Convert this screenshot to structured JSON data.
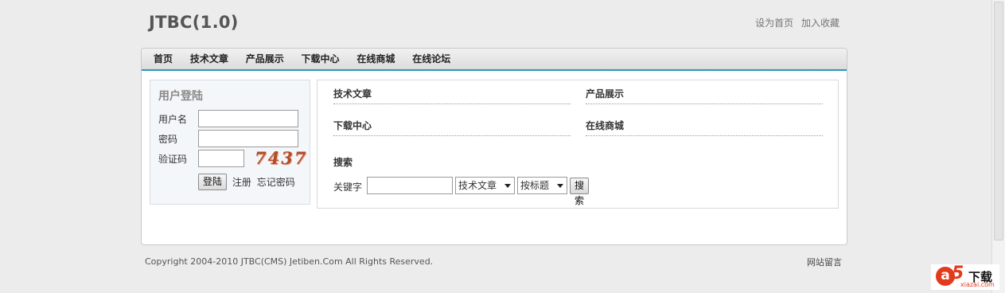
{
  "header": {
    "logo": "JTBC(1.0)",
    "links": [
      "设为首页",
      "加入收藏"
    ]
  },
  "nav": {
    "items": [
      "首页",
      "技术文章",
      "产品展示",
      "下载中心",
      "在线商城",
      "在线论坛"
    ]
  },
  "login": {
    "title": "用户登陆",
    "username_label": "用户名",
    "username_value": "",
    "password_label": "密码",
    "password_value": "",
    "captcha_label": "验证码",
    "captcha_value": "",
    "captcha_text": "7437",
    "submit_label": "登陆",
    "register_label": "注册",
    "forgot_label": "忘记密码"
  },
  "categories": [
    "技术文章",
    "产品展示",
    "下载中心",
    "在线商城"
  ],
  "search": {
    "title": "搜索",
    "keyword_label": "关键字",
    "keyword_value": "",
    "module_selected": "技术文章",
    "field_selected": "按标题",
    "button_label": "搜索"
  },
  "footer": {
    "copyright": "Copyright 2004-2010 JTBC(CMS) Jetiben.Com All Rights Reserved.",
    "guestbook": "网站留言"
  },
  "watermark": {
    "brand": "a5",
    "title": "下载",
    "domain": "xiazai.com"
  },
  "colors": {
    "accent": "#2b97b8",
    "captcha": "#b34b2a",
    "watermark": "#e23a1c"
  }
}
